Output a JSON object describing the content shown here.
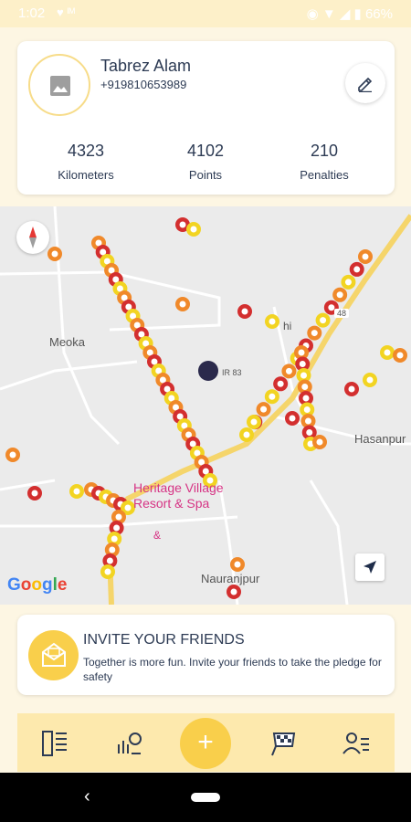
{
  "status_bar": {
    "time": "1:02",
    "left_icons": "♥ ᴵᴹ",
    "battery": "66%",
    "right_icons": "◉ ▼ ◢ ▮"
  },
  "profile": {
    "name": "Tabrez Alam",
    "phone": "+919810653989",
    "stats": [
      {
        "value": "4323",
        "label": "Kilometers"
      },
      {
        "value": "4102",
        "label": "Points"
      },
      {
        "value": "210",
        "label": "Penalties"
      }
    ]
  },
  "map": {
    "labels": {
      "meoka": "Meoka",
      "hasanpur": "Hasanpur",
      "nauranjpur": "Nauranjpur",
      "road_48": "48",
      "road_83": "IR 83",
      "hi": "hi",
      "poi_line1": "Heritage Village",
      "poi_line2": "Resort & Spa",
      "poi_amp": "&"
    },
    "google": [
      "G",
      "o",
      "o",
      "g",
      "l",
      "e"
    ],
    "colors": {
      "red_marker": "#d32f2f",
      "orange_marker": "#f0892a",
      "yellow_marker": "#f2d422",
      "road": "#f5d56b"
    }
  },
  "invite": {
    "title": "INVITE YOUR FRIENDS",
    "text": "Together is more fun. Invite your friends to take the pledge for safety"
  },
  "bottom_nav": {
    "items": [
      "dashboard-icon",
      "stats-icon",
      "add-icon",
      "race-flag-icon",
      "profile-list-icon"
    ],
    "fab_label": "+"
  },
  "system_nav": {
    "back": "‹"
  }
}
